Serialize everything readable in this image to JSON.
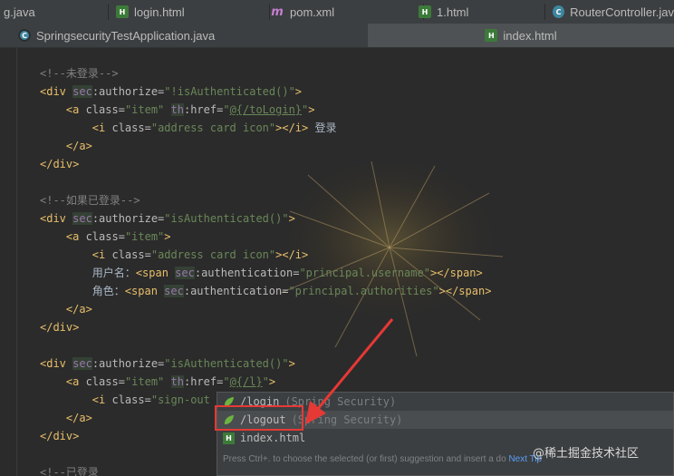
{
  "tabs_row1": [
    {
      "label": "g.java",
      "icon": "java-class-icon"
    },
    {
      "label": "login.html",
      "icon": "html-file-icon"
    },
    {
      "label": "pom.xml",
      "icon": "maven-icon"
    },
    {
      "label": "1.html",
      "icon": "html-file-icon"
    },
    {
      "label": "RouterController.jav",
      "icon": "class-icon"
    }
  ],
  "tabs_row2": [
    {
      "label": "SpringsecurityTestApplication.java",
      "icon": "spring-app-icon"
    },
    {
      "label": "index.html",
      "icon": "html-file-icon",
      "active": true
    }
  ],
  "code_lines": [
    "<!--未登录-->",
    "<div sec:authorize=\"!isAuthenticated()\">",
    "    <a class=\"item\" th:href=\"@{/toLogin}\">",
    "        <i class=\"address card icon\"></i> 登录",
    "    </a>",
    "</div>",
    "",
    "<!--如果已登录-->",
    "<div sec:authorize=\"isAuthenticated()\">",
    "    <a class=\"item\">",
    "        <i class=\"address card icon\"></i>",
    "        用户名：<span sec:authentication=\"principal.username\"></span>",
    "        角色：<span sec:authentication=\"principal.authorities\"></span>",
    "    </a>",
    "</div>",
    "",
    "<div sec:authorize=\"isAuthenticated()\">",
    "    <a class=\"item\" th:href=\"@{/l}\">",
    "        <i class=\"sign-out i",
    "    </a>",
    "</div>",
    "",
    "<!--已登录"
  ],
  "completion": {
    "items": [
      {
        "label": "/login",
        "hint": "(Spring Security)",
        "icon": "spring-leaf-icon"
      },
      {
        "label": "/logout",
        "hint": "(Spring Security)",
        "icon": "spring-leaf-icon",
        "selected": true
      },
      {
        "label": "index.html",
        "hint": "",
        "icon": "html-file-icon"
      }
    ],
    "footer_text": "Press Ctrl+. to choose the selected (or first) suggestion and insert a do",
    "footer_link": "Next Tip"
  },
  "watermark": "@稀土掘金技术社区",
  "colors": {
    "background": "#2b2b2b",
    "tag": "#e8bf6a",
    "string": "#6a8759",
    "comment": "#808080",
    "annotation_box": "#e53935"
  }
}
